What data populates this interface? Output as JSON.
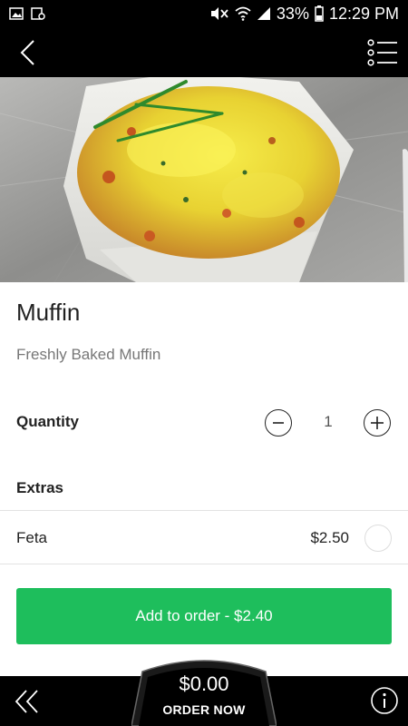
{
  "status_bar": {
    "battery": "33%",
    "time": "12:29 PM",
    "icons": [
      "image-icon",
      "screenshot-icon",
      "mute-icon",
      "wifi-icon",
      "signal-icon",
      "battery-icon"
    ]
  },
  "nav": {
    "back_icon": "chevron-left-icon",
    "menu_icon": "list-menu-icon"
  },
  "product": {
    "title": "Muffin",
    "description": "Freshly Baked Muffin",
    "image": "muffin-photo"
  },
  "quantity": {
    "label": "Quantity",
    "value": "1"
  },
  "extras": {
    "label": "Extras",
    "items": [
      {
        "name": "Feta",
        "price": "$2.50",
        "selected": false
      }
    ]
  },
  "add_button": {
    "label": "Add to order - $2.40",
    "color": "#1ebe5c"
  },
  "bottom_bar": {
    "order_total": "$0.00",
    "order_label": "ORDER NOW",
    "back_icon": "double-chevron-left-icon",
    "info_icon": "info-icon"
  }
}
